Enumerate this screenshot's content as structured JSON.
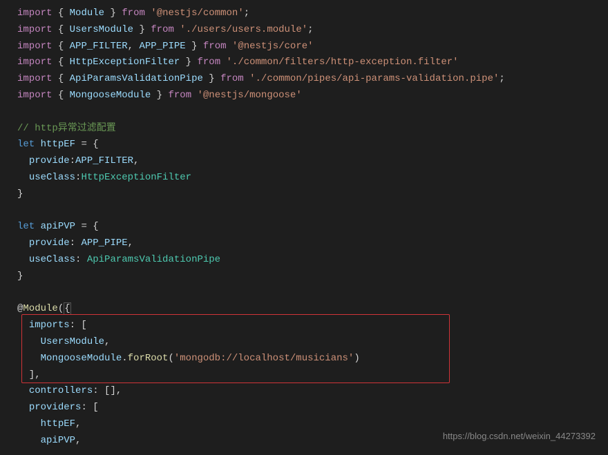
{
  "code": {
    "lines": [
      {
        "tokens": [
          {
            "type": "kw-import",
            "text": "import"
          },
          {
            "type": "punctuation",
            "text": " { "
          },
          {
            "type": "identifier",
            "text": "Module"
          },
          {
            "type": "punctuation",
            "text": " } "
          },
          {
            "type": "kw-from",
            "text": "from"
          },
          {
            "type": "punctuation",
            "text": " "
          },
          {
            "type": "string",
            "text": "'@nestjs/common'"
          },
          {
            "type": "punctuation",
            "text": ";"
          }
        ]
      },
      {
        "tokens": [
          {
            "type": "kw-import",
            "text": "import"
          },
          {
            "type": "punctuation",
            "text": " { "
          },
          {
            "type": "identifier",
            "text": "UsersModule"
          },
          {
            "type": "punctuation",
            "text": " } "
          },
          {
            "type": "kw-from",
            "text": "from"
          },
          {
            "type": "punctuation",
            "text": " "
          },
          {
            "type": "string",
            "text": "'./users/users.module'"
          },
          {
            "type": "punctuation",
            "text": ";"
          }
        ]
      },
      {
        "tokens": [
          {
            "type": "kw-import",
            "text": "import"
          },
          {
            "type": "punctuation",
            "text": " { "
          },
          {
            "type": "identifier",
            "text": "APP_FILTER"
          },
          {
            "type": "punctuation",
            "text": ", "
          },
          {
            "type": "identifier",
            "text": "APP_PIPE"
          },
          {
            "type": "punctuation",
            "text": " } "
          },
          {
            "type": "kw-from",
            "text": "from"
          },
          {
            "type": "punctuation",
            "text": " "
          },
          {
            "type": "string",
            "text": "'@nestjs/core'"
          }
        ]
      },
      {
        "tokens": [
          {
            "type": "kw-import",
            "text": "import"
          },
          {
            "type": "punctuation",
            "text": " { "
          },
          {
            "type": "identifier",
            "text": "HttpExceptionFilter"
          },
          {
            "type": "punctuation",
            "text": " } "
          },
          {
            "type": "kw-from",
            "text": "from"
          },
          {
            "type": "punctuation",
            "text": " "
          },
          {
            "type": "string",
            "text": "'./common/filters/http-exception.filter'"
          }
        ]
      },
      {
        "tokens": [
          {
            "type": "kw-import",
            "text": "import"
          },
          {
            "type": "punctuation",
            "text": " { "
          },
          {
            "type": "identifier",
            "text": "ApiParamsValidationPipe"
          },
          {
            "type": "punctuation",
            "text": " } "
          },
          {
            "type": "kw-from",
            "text": "from"
          },
          {
            "type": "punctuation",
            "text": " "
          },
          {
            "type": "string",
            "text": "'./common/pipes/api-params-validation.pipe'"
          },
          {
            "type": "punctuation",
            "text": ";"
          }
        ]
      },
      {
        "tokens": [
          {
            "type": "kw-import",
            "text": "import"
          },
          {
            "type": "punctuation",
            "text": " { "
          },
          {
            "type": "identifier",
            "text": "MongooseModule"
          },
          {
            "type": "punctuation",
            "text": " } "
          },
          {
            "type": "kw-from",
            "text": "from"
          },
          {
            "type": "punctuation",
            "text": " "
          },
          {
            "type": "string",
            "text": "'@nestjs/mongoose'"
          }
        ]
      },
      {
        "tokens": [
          {
            "type": "punctuation",
            "text": ""
          }
        ]
      },
      {
        "tokens": [
          {
            "type": "comment",
            "text": "// http异常过滤配置"
          }
        ]
      },
      {
        "tokens": [
          {
            "type": "kw-let",
            "text": "let"
          },
          {
            "type": "punctuation",
            "text": " "
          },
          {
            "type": "identifier",
            "text": "httpEF"
          },
          {
            "type": "punctuation",
            "text": " = {"
          }
        ]
      },
      {
        "tokens": [
          {
            "type": "punctuation",
            "text": "  "
          },
          {
            "type": "property",
            "text": "provide"
          },
          {
            "type": "punctuation",
            "text": ":"
          },
          {
            "type": "identifier",
            "text": "APP_FILTER"
          },
          {
            "type": "punctuation",
            "text": ","
          }
        ]
      },
      {
        "tokens": [
          {
            "type": "punctuation",
            "text": "  "
          },
          {
            "type": "property",
            "text": "useClass"
          },
          {
            "type": "punctuation",
            "text": ":"
          },
          {
            "type": "type",
            "text": "HttpExceptionFilter"
          }
        ]
      },
      {
        "tokens": [
          {
            "type": "punctuation",
            "text": "}"
          }
        ]
      },
      {
        "tokens": [
          {
            "type": "punctuation",
            "text": ""
          }
        ]
      },
      {
        "tokens": [
          {
            "type": "kw-let",
            "text": "let"
          },
          {
            "type": "punctuation",
            "text": " "
          },
          {
            "type": "identifier",
            "text": "apiPVP"
          },
          {
            "type": "punctuation",
            "text": " = {"
          }
        ]
      },
      {
        "tokens": [
          {
            "type": "punctuation",
            "text": "  "
          },
          {
            "type": "property",
            "text": "provide"
          },
          {
            "type": "punctuation",
            "text": ": "
          },
          {
            "type": "identifier",
            "text": "APP_PIPE"
          },
          {
            "type": "punctuation",
            "text": ","
          }
        ]
      },
      {
        "tokens": [
          {
            "type": "punctuation",
            "text": "  "
          },
          {
            "type": "property",
            "text": "useClass"
          },
          {
            "type": "punctuation",
            "text": ": "
          },
          {
            "type": "type",
            "text": "ApiParamsValidationPipe"
          }
        ]
      },
      {
        "tokens": [
          {
            "type": "punctuation",
            "text": "}"
          }
        ]
      },
      {
        "tokens": [
          {
            "type": "punctuation",
            "text": ""
          }
        ]
      },
      {
        "tokens": [
          {
            "type": "decorator-at",
            "text": "@"
          },
          {
            "type": "decorator-name",
            "text": "Module"
          },
          {
            "type": "punctuation",
            "text": "("
          },
          {
            "type": "bracket-highlight",
            "text": "{"
          }
        ]
      },
      {
        "tokens": [
          {
            "type": "punctuation",
            "text": "  "
          },
          {
            "type": "property",
            "text": "imports"
          },
          {
            "type": "punctuation",
            "text": ": ["
          }
        ]
      },
      {
        "tokens": [
          {
            "type": "punctuation",
            "text": "    "
          },
          {
            "type": "identifier",
            "text": "UsersModule"
          },
          {
            "type": "punctuation",
            "text": ","
          }
        ]
      },
      {
        "tokens": [
          {
            "type": "punctuation",
            "text": "    "
          },
          {
            "type": "identifier",
            "text": "MongooseModule"
          },
          {
            "type": "punctuation",
            "text": "."
          },
          {
            "type": "method",
            "text": "forRoot"
          },
          {
            "type": "punctuation",
            "text": "("
          },
          {
            "type": "string",
            "text": "'mongodb://localhost/musicians'"
          },
          {
            "type": "punctuation",
            "text": ")"
          }
        ]
      },
      {
        "tokens": [
          {
            "type": "punctuation",
            "text": "  ],"
          }
        ]
      },
      {
        "tokens": [
          {
            "type": "punctuation",
            "text": "  "
          },
          {
            "type": "property",
            "text": "controllers"
          },
          {
            "type": "punctuation",
            "text": ": [],"
          }
        ]
      },
      {
        "tokens": [
          {
            "type": "punctuation",
            "text": "  "
          },
          {
            "type": "property",
            "text": "providers"
          },
          {
            "type": "punctuation",
            "text": ": ["
          }
        ]
      },
      {
        "tokens": [
          {
            "type": "punctuation",
            "text": "    "
          },
          {
            "type": "identifier",
            "text": "httpEF"
          },
          {
            "type": "punctuation",
            "text": ","
          }
        ]
      },
      {
        "tokens": [
          {
            "type": "punctuation",
            "text": "    "
          },
          {
            "type": "identifier",
            "text": "apiPVP"
          },
          {
            "type": "punctuation",
            "text": ","
          }
        ]
      }
    ]
  },
  "watermark": "https://blog.csdn.net/weixin_44273392"
}
